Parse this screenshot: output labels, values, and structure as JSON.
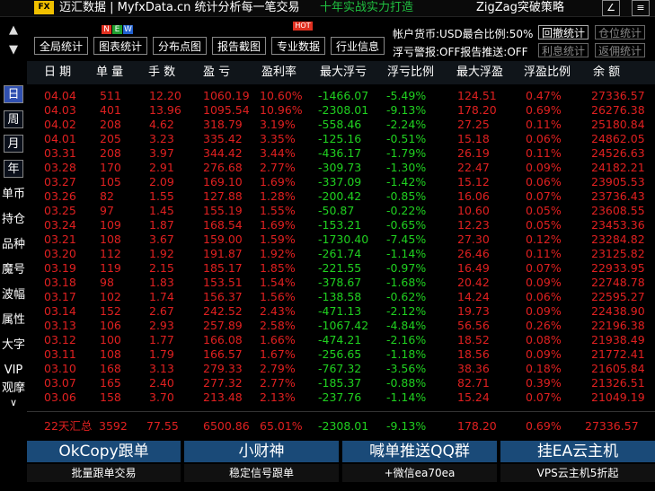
{
  "titlebar": {
    "logo": "FX",
    "title": "迈汇数据 | MyfxData.cn  统计分析每一笔交易",
    "slogan": "十年实战实力打造",
    "strategy": "ZigZag突破策略",
    "edit_btn": "∠",
    "menu_btn": "≡"
  },
  "toolbar": {
    "buttons": [
      "全局统计",
      "图表统计",
      "分布点图",
      "报告截图",
      "专业数据",
      "行业信息"
    ],
    "new_badge": [
      "N",
      "E",
      "W"
    ],
    "hot_badge": "HOT"
  },
  "info": {
    "line1": "帐户货币:USD最合比例:50%",
    "line2": "浮亏警报:OFF报告推送:OFF",
    "btn_recall": "回撤统计",
    "btn_position": "仓位统计",
    "btn_profit": "利息统计",
    "btn_back": "返佣统计"
  },
  "columns": [
    "日 期",
    "单 量",
    "手 数",
    "盈 亏",
    "盈利率",
    "最大浮亏",
    "浮亏比例",
    "最大浮盈",
    "浮盈比例",
    "余 额"
  ],
  "side": [
    "日",
    "周",
    "月",
    "年",
    "单币",
    "持仓",
    "品种",
    "魔号",
    "波幅",
    "属性",
    "大字",
    "VIP",
    "观摩",
    "∨"
  ],
  "scroll": {
    "up": "▲",
    "down": "▼"
  },
  "rows": [
    [
      "04.04",
      "511",
      "12.20",
      "1060.19",
      "10.60%",
      "-1466.07",
      "-5.49%",
      "124.51",
      "0.47%",
      "27336.57"
    ],
    [
      "04.03",
      "401",
      "13.96",
      "1095.54",
      "10.96%",
      "-2308.01",
      "-9.13%",
      "178.20",
      "0.69%",
      "26276.38"
    ],
    [
      "04.02",
      "208",
      "4.62",
      "318.79",
      "3.19%",
      "-558.46",
      "-2.24%",
      "27.25",
      "0.11%",
      "25180.84"
    ],
    [
      "04.01",
      "205",
      "3.23",
      "335.42",
      "3.35%",
      "-125.16",
      "-0.51%",
      "15.18",
      "0.06%",
      "24862.05"
    ],
    [
      "03.31",
      "208",
      "3.97",
      "344.42",
      "3.44%",
      "-436.17",
      "-1.79%",
      "26.19",
      "0.11%",
      "24526.63"
    ],
    [
      "03.28",
      "170",
      "2.91",
      "276.68",
      "2.77%",
      "-309.73",
      "-1.30%",
      "22.47",
      "0.09%",
      "24182.21"
    ],
    [
      "03.27",
      "105",
      "2.09",
      "169.10",
      "1.69%",
      "-337.09",
      "-1.42%",
      "15.12",
      "0.06%",
      "23905.53"
    ],
    [
      "03.26",
      "82",
      "1.55",
      "127.88",
      "1.28%",
      "-200.42",
      "-0.85%",
      "16.06",
      "0.07%",
      "23736.43"
    ],
    [
      "03.25",
      "97",
      "1.45",
      "155.19",
      "1.55%",
      "-50.87",
      "-0.22%",
      "10.60",
      "0.05%",
      "23608.55"
    ],
    [
      "03.24",
      "109",
      "1.87",
      "168.54",
      "1.69%",
      "-153.21",
      "-0.65%",
      "12.23",
      "0.05%",
      "23453.36"
    ],
    [
      "03.21",
      "108",
      "3.67",
      "159.00",
      "1.59%",
      "-1730.40",
      "-7.45%",
      "27.30",
      "0.12%",
      "23284.82"
    ],
    [
      "03.20",
      "112",
      "1.92",
      "191.87",
      "1.92%",
      "-261.74",
      "-1.14%",
      "26.46",
      "0.11%",
      "23125.82"
    ],
    [
      "03.19",
      "119",
      "2.15",
      "185.17",
      "1.85%",
      "-221.55",
      "-0.97%",
      "16.49",
      "0.07%",
      "22933.95"
    ],
    [
      "03.18",
      "98",
      "1.83",
      "153.51",
      "1.54%",
      "-378.67",
      "-1.68%",
      "20.42",
      "0.09%",
      "22748.78"
    ],
    [
      "03.17",
      "102",
      "1.74",
      "156.37",
      "1.56%",
      "-138.58",
      "-0.62%",
      "14.24",
      "0.06%",
      "22595.27"
    ],
    [
      "03.14",
      "152",
      "2.67",
      "242.52",
      "2.43%",
      "-471.13",
      "-2.12%",
      "19.73",
      "0.09%",
      "22438.90"
    ],
    [
      "03.13",
      "106",
      "2.93",
      "257.89",
      "2.58%",
      "-1067.42",
      "-4.84%",
      "56.56",
      "0.26%",
      "22196.38"
    ],
    [
      "03.12",
      "100",
      "1.77",
      "166.08",
      "1.66%",
      "-474.21",
      "-2.16%",
      "18.52",
      "0.08%",
      "21938.49"
    ],
    [
      "03.11",
      "108",
      "1.79",
      "166.57",
      "1.67%",
      "-256.65",
      "-1.18%",
      "18.56",
      "0.09%",
      "21772.41"
    ],
    [
      "03.10",
      "168",
      "3.13",
      "279.33",
      "2.79%",
      "-767.32",
      "-3.56%",
      "38.36",
      "0.18%",
      "21605.84"
    ],
    [
      "03.07",
      "165",
      "2.40",
      "277.32",
      "2.77%",
      "-185.37",
      "-0.88%",
      "82.71",
      "0.39%",
      "21326.51"
    ],
    [
      "03.06",
      "158",
      "3.70",
      "213.48",
      "2.13%",
      "-237.76",
      "-1.14%",
      "15.24",
      "0.07%",
      "21049.19"
    ]
  ],
  "summary": [
    "22天汇总",
    "3592",
    "77.55",
    "6500.86",
    "65.01%",
    "-2308.01",
    "-9.13%",
    "178.20",
    "0.69%",
    "27336.57"
  ],
  "ads": [
    {
      "top": "OkCopy跟单",
      "bottom": "批量跟单交易"
    },
    {
      "top": "小财神",
      "bottom": "稳定信号跟单"
    },
    {
      "top": "喊单推送QQ群",
      "bottom": "+微信ea70ea"
    },
    {
      "top": "挂EA云主机",
      "bottom": "VPS云主机5折起"
    }
  ],
  "colors": {
    "negative_green": "#20d020",
    "positive_red": "#e02020",
    "ad_blue": "#1a4a78",
    "active_side": "#3050b0"
  }
}
